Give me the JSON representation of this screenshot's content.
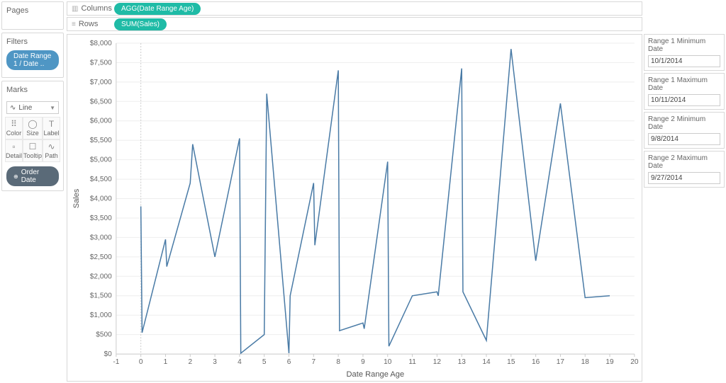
{
  "sidebar": {
    "pages_title": "Pages",
    "filters_title": "Filters",
    "filter_pill": "Date Range 1 / Date ..",
    "marks_title": "Marks",
    "mark_type": "Line",
    "mark_buttons": [
      {
        "icon": "⠿",
        "label": "Color"
      },
      {
        "icon": "◯",
        "label": "Size"
      },
      {
        "icon": "T",
        "label": "Label"
      },
      {
        "icon": "▫",
        "label": "Detail"
      },
      {
        "icon": "☐",
        "label": "Tooltip"
      },
      {
        "icon": "∿",
        "label": "Path"
      }
    ],
    "mark_pill": "Order Date"
  },
  "shelves": {
    "columns_label": "Columns",
    "columns_pill": "AGG(Date Range Age)",
    "rows_label": "Rows",
    "rows_pill": "SUM(Sales)"
  },
  "params": [
    {
      "label": "Range 1 Minimum Date",
      "value": "10/1/2014"
    },
    {
      "label": "Range 1 Maximum Date",
      "value": "10/11/2014"
    },
    {
      "label": "Range 2 Minimum Date",
      "value": "9/8/2014"
    },
    {
      "label": "Range 2 Maximum Date",
      "value": "9/27/2014"
    }
  ],
  "chart_data": {
    "type": "line",
    "xlabel": "Date Range Age",
    "ylabel": "Sales",
    "xlim": [
      -1,
      20
    ],
    "ylim": [
      0,
      8000
    ],
    "y_ticks": [
      0,
      500,
      1000,
      1500,
      2000,
      2500,
      3000,
      3500,
      4000,
      4500,
      5000,
      5500,
      6000,
      6500,
      7000,
      7500,
      8000
    ],
    "y_tick_labels": [
      "$0",
      "$500",
      "$1,000",
      "$1,500",
      "$2,000",
      "$2,500",
      "$3,000",
      "$3,500",
      "$4,000",
      "$4,500",
      "$5,000",
      "$5,500",
      "$6,000",
      "$6,500",
      "$7,000",
      "$7,500",
      "$8,000"
    ],
    "x_ticks": [
      -1,
      0,
      1,
      2,
      3,
      4,
      5,
      6,
      7,
      8,
      9,
      10,
      11,
      12,
      13,
      14,
      15,
      16,
      17,
      18,
      19,
      20
    ],
    "points": [
      {
        "x": 0.0,
        "y": 3800
      },
      {
        "x": 0.05,
        "y": 550
      },
      {
        "x": 1.0,
        "y": 2950
      },
      {
        "x": 1.05,
        "y": 2250
      },
      {
        "x": 2.0,
        "y": 4400
      },
      {
        "x": 2.1,
        "y": 5400
      },
      {
        "x": 3.0,
        "y": 2500
      },
      {
        "x": 4.0,
        "y": 5550
      },
      {
        "x": 4.05,
        "y": 20
      },
      {
        "x": 5.0,
        "y": 500
      },
      {
        "x": 5.1,
        "y": 6700
      },
      {
        "x": 6.0,
        "y": 20
      },
      {
        "x": 6.05,
        "y": 1500
      },
      {
        "x": 7.0,
        "y": 4400
      },
      {
        "x": 7.05,
        "y": 2800
      },
      {
        "x": 8.0,
        "y": 7300
      },
      {
        "x": 8.05,
        "y": 600
      },
      {
        "x": 9.0,
        "y": 800
      },
      {
        "x": 9.05,
        "y": 650
      },
      {
        "x": 10.0,
        "y": 4950
      },
      {
        "x": 10.05,
        "y": 200
      },
      {
        "x": 11.0,
        "y": 1500
      },
      {
        "x": 12.0,
        "y": 1600
      },
      {
        "x": 12.05,
        "y": 1500
      },
      {
        "x": 13.0,
        "y": 7350
      },
      {
        "x": 13.05,
        "y": 1600
      },
      {
        "x": 14.0,
        "y": 350
      },
      {
        "x": 15.0,
        "y": 7850
      },
      {
        "x": 16.0,
        "y": 2400
      },
      {
        "x": 17.0,
        "y": 6450
      },
      {
        "x": 18.0,
        "y": 1450
      },
      {
        "x": 19.0,
        "y": 1500
      }
    ]
  }
}
